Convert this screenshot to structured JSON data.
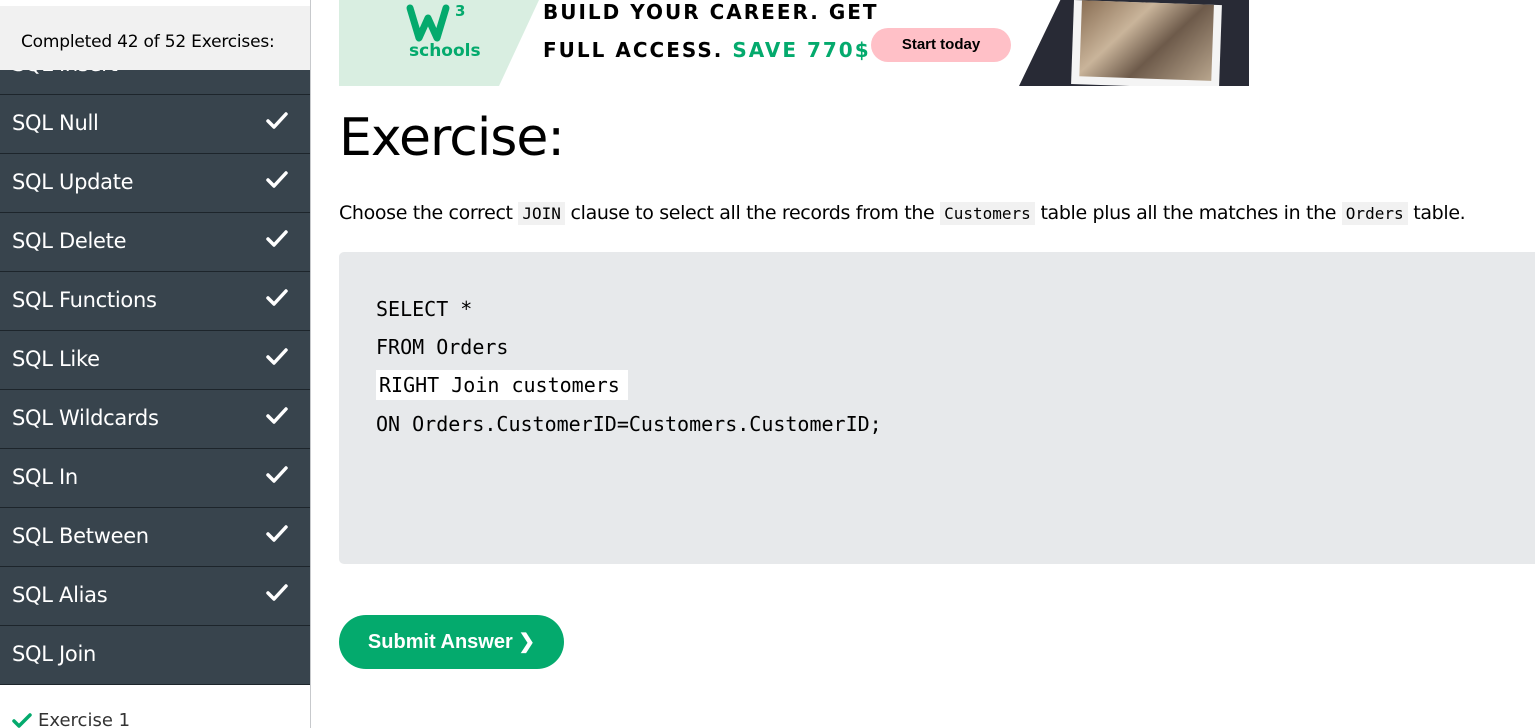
{
  "sidebar": {
    "progress_text": "Completed 42 of 52 Exercises:",
    "items": [
      {
        "label": "SQL Insert",
        "done": true
      },
      {
        "label": "SQL Null",
        "done": true
      },
      {
        "label": "SQL Update",
        "done": true
      },
      {
        "label": "SQL Delete",
        "done": true
      },
      {
        "label": "SQL Functions",
        "done": true
      },
      {
        "label": "SQL Like",
        "done": true
      },
      {
        "label": "SQL Wildcards",
        "done": true
      },
      {
        "label": "SQL In",
        "done": true
      },
      {
        "label": "SQL Between",
        "done": true
      },
      {
        "label": "SQL Alias",
        "done": true
      },
      {
        "label": "SQL Join",
        "done": false
      }
    ],
    "sub_item": {
      "label": "Exercise 1",
      "done": true
    }
  },
  "banner": {
    "logo_superscript": "3",
    "logo_text": "schools",
    "line1": "BUILD YOUR CAREER. GET",
    "line2_prefix": "FULL ACCESS. ",
    "line2_highlight": "SAVE 770$",
    "cta_label": "Start today"
  },
  "main": {
    "title": "Exercise:",
    "instructions": {
      "p1": "Choose the correct ",
      "code1": "JOIN",
      "p2": " clause to select all the records from the ",
      "code2": "Customers",
      "p3": " table plus all the matches in the ",
      "code3": "Orders",
      "p4": " table."
    },
    "code": {
      "line1": "SELECT *",
      "line2": "FROM Orders",
      "answer_value": "RIGHT Join customers",
      "line4": "ON Orders.CustomerID=Customers.CustomerID;"
    },
    "submit_label": "Submit Answer ❯"
  },
  "colors": {
    "sidebar_bg": "#38444d",
    "accent_green": "#04aa6d",
    "code_bg": "#e7e9eb",
    "cta_pink": "#ffc0c7"
  }
}
